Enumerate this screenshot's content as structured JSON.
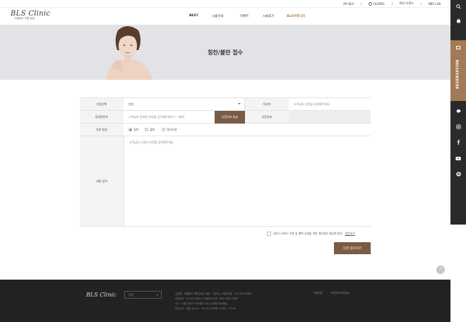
{
  "util_bar": {
    "items": [
      "MY BLS",
      "GLOBAL",
      "BLS 브랜드",
      "BBS LAB"
    ]
  },
  "header": {
    "logo_mark": "BLS Clinic",
    "logo_sub": "비엘에스 의원 본점",
    "menu": [
      "BEST",
      "시술안내",
      "이벤트",
      "시술후기",
      "BLS커뮤니티"
    ]
  },
  "hero": {
    "title": "칭찬/불만 접수"
  },
  "form": {
    "branch_label": "지점선택",
    "branch_value": "본점",
    "writer_label": "작성자",
    "writer_placeholder": "고객님의 성함을 입력해주세요.",
    "phone_label": "휴대폰번호",
    "phone_placeholder": "고객님의 휴대폰 번호를 입력해주세요 ('-' 제외)",
    "auth_button": "인증번호 발송",
    "auth_label": "인증번호",
    "type_label": "의견 분류",
    "type_options": [
      "칭찬",
      "불만",
      "개선의견"
    ],
    "content_label": "내용 입력",
    "content_placeholder": "고객님의 소중한 의견을 입력해주세요."
  },
  "agree": {
    "text": "[필수] 서비스 이용 및 예약 신청을 위한 개인정보 제공에 동의",
    "link": "전문보기"
  },
  "submit_label": "의견 접수하기",
  "footer": {
    "logo": "BLS Clinic",
    "select_value": "본점",
    "info": [
      "상호명 : 비엘에스 의원 본점  |  대표 : 이승재  |  사업자번호 : 123-45-67890",
      "대표번호 : 02-547-8962  |  의료광고심의 : 000-0000-0000",
      "주소 : 서울 강남구 도산대로 123 (신사동) BLS빌딩",
      "운영시간 : 평일 10:00 ~ 20:00  |  토요일 10:00 ~ 17:00"
    ],
    "links": [
      "이용약관",
      "개인정보처리방침"
    ]
  },
  "quick_bar": {
    "reservation": "RESERVATION",
    "icons": [
      "search-icon",
      "bag-icon",
      "calendar-icon",
      "chat-icon",
      "instagram-icon",
      "facebook-icon",
      "youtube-icon",
      "blog-icon"
    ]
  },
  "colors": {
    "accent_brown": "#7a5b44",
    "reservation_brown": "#a37a55",
    "footer_bg": "#222222",
    "hero_bg": "#e2e3e7"
  }
}
